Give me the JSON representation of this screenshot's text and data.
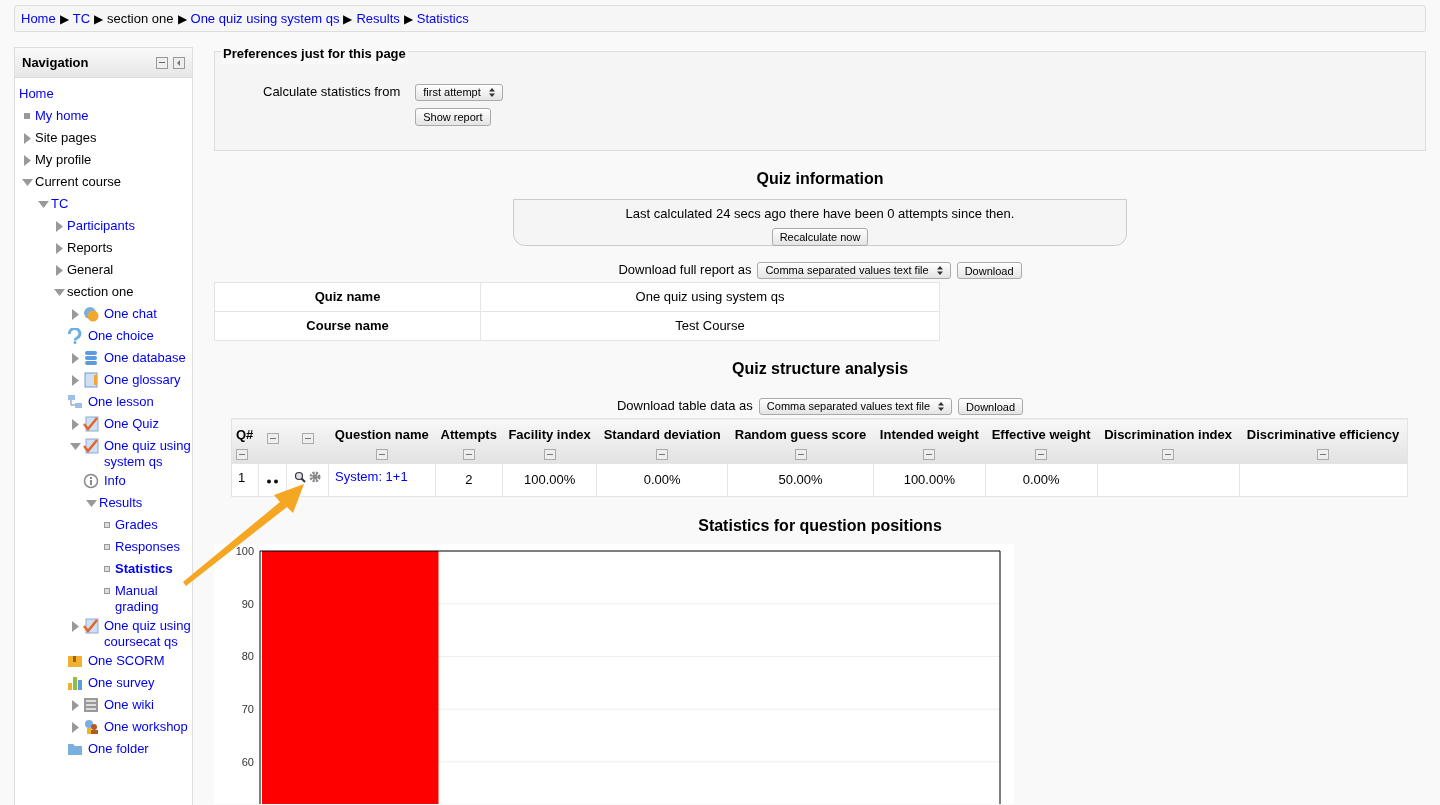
{
  "breadcrumb": [
    {
      "label": "Home",
      "link": true
    },
    {
      "label": "TC",
      "link": true
    },
    {
      "label": "section one",
      "link": false
    },
    {
      "label": "One quiz using system qs",
      "link": true
    },
    {
      "label": "Results",
      "link": true
    },
    {
      "label": "Statistics",
      "link": true
    }
  ],
  "breadcrumb_separator": "▶",
  "navigation": {
    "title": "Navigation",
    "items": [
      {
        "label": "Home",
        "link": true
      },
      {
        "label": "My home",
        "kind": "bullet",
        "link": true
      },
      {
        "label": "Site pages",
        "link": false,
        "expanded": false
      },
      {
        "label": "My profile",
        "link": false,
        "expanded": false
      },
      {
        "label": "Current course",
        "link": false,
        "expanded": true,
        "children": [
          {
            "label": "TC",
            "link": true,
            "expanded": true,
            "children": [
              {
                "label": "Participants",
                "link": true,
                "expanded": false
              },
              {
                "label": "Reports",
                "link": false,
                "expanded": false
              },
              {
                "label": "General",
                "link": false,
                "expanded": false
              },
              {
                "label": "section one",
                "link": false,
                "expanded": true,
                "children": [
                  {
                    "label": "One chat",
                    "kind": "chat",
                    "link": true,
                    "expanded": false
                  },
                  {
                    "label": "One choice",
                    "kind": "choice",
                    "link": true
                  },
                  {
                    "label": "One database",
                    "kind": "database",
                    "link": true,
                    "expanded": false
                  },
                  {
                    "label": "One glossary",
                    "kind": "glossary",
                    "link": true,
                    "expanded": false
                  },
                  {
                    "label": "One lesson",
                    "kind": "lesson",
                    "link": true
                  },
                  {
                    "label": "One Quiz",
                    "kind": "quiz",
                    "link": true,
                    "expanded": false
                  },
                  {
                    "label": "One quiz using system qs",
                    "kind": "quiz",
                    "link": true,
                    "expanded": true,
                    "children": [
                      {
                        "label": "Info",
                        "kind": "info",
                        "link": true
                      },
                      {
                        "label": "Results",
                        "link": true,
                        "expanded": true,
                        "children": [
                          {
                            "label": "Grades",
                            "kind": "square",
                            "link": true,
                            "selected": false
                          },
                          {
                            "label": "Responses",
                            "kind": "square",
                            "link": true,
                            "selected": false
                          },
                          {
                            "label": "Statistics",
                            "kind": "square",
                            "link": true,
                            "selected": true
                          },
                          {
                            "label": "Manual grading",
                            "kind": "square",
                            "link": true,
                            "selected": false
                          }
                        ]
                      }
                    ]
                  },
                  {
                    "label": "One quiz using coursecat qs",
                    "kind": "quiz",
                    "link": true,
                    "expanded": false
                  },
                  {
                    "label": "One SCORM",
                    "kind": "scorm",
                    "link": true
                  },
                  {
                    "label": "One survey",
                    "kind": "survey",
                    "link": true
                  },
                  {
                    "label": "One wiki",
                    "kind": "wiki",
                    "link": true,
                    "expanded": false
                  },
                  {
                    "label": "One workshop",
                    "kind": "workshop",
                    "link": true,
                    "expanded": false
                  },
                  {
                    "label": "One folder",
                    "kind": "folder",
                    "link": true
                  }
                ]
              }
            ]
          }
        ]
      }
    ]
  },
  "preferences": {
    "legend": "Preferences just for this page",
    "label": "Calculate statistics from",
    "select": "first attempt",
    "button": "Show report"
  },
  "quiz_information": {
    "heading": "Quiz information",
    "notice": "Last calculated 24 secs ago there have been 0 attempts since then.",
    "recalculate_button": "Recalculate now",
    "download_label": "Download full report as",
    "download_format": "Comma separated values text file",
    "download_button": "Download",
    "rows": [
      {
        "label": "Quiz name",
        "value": "One quiz using system qs"
      },
      {
        "label": "Course name",
        "value": "Test Course"
      }
    ]
  },
  "structure": {
    "heading": "Quiz structure analysis",
    "download_label": "Download table data as",
    "download_format": "Comma separated values text file",
    "download_button": "Download",
    "columns": [
      {
        "kind": "text",
        "label": "Q#"
      },
      {
        "kind": "icon_only"
      },
      {
        "kind": "icon_only"
      },
      {
        "kind": "text",
        "label": "Question name"
      },
      {
        "kind": "text",
        "label": "Attempts"
      },
      {
        "kind": "text",
        "label": "Facility index"
      },
      {
        "kind": "text",
        "label": "Standard deviation"
      },
      {
        "kind": "text",
        "label": "Random guess score"
      },
      {
        "kind": "text",
        "label": "Intended weight"
      },
      {
        "kind": "text",
        "label": "Effective weight"
      },
      {
        "kind": "text",
        "label": "Discrimination index"
      },
      {
        "kind": "text",
        "label": "Discriminative efficiency"
      }
    ],
    "rows": [
      {
        "number": "1",
        "question_name": "System: 1+1",
        "values": [
          "2",
          "100.00%",
          "0.00%",
          "50.00%",
          "100.00%",
          "0.00%"
        ]
      }
    ]
  },
  "positions": {
    "heading": "Statistics for question positions",
    "chart_data": {
      "type": "bar",
      "values": [
        100
      ],
      "ylim": [
        52,
        100
      ],
      "yticks": [
        60,
        70,
        80,
        90,
        100
      ],
      "grid": true
    }
  }
}
